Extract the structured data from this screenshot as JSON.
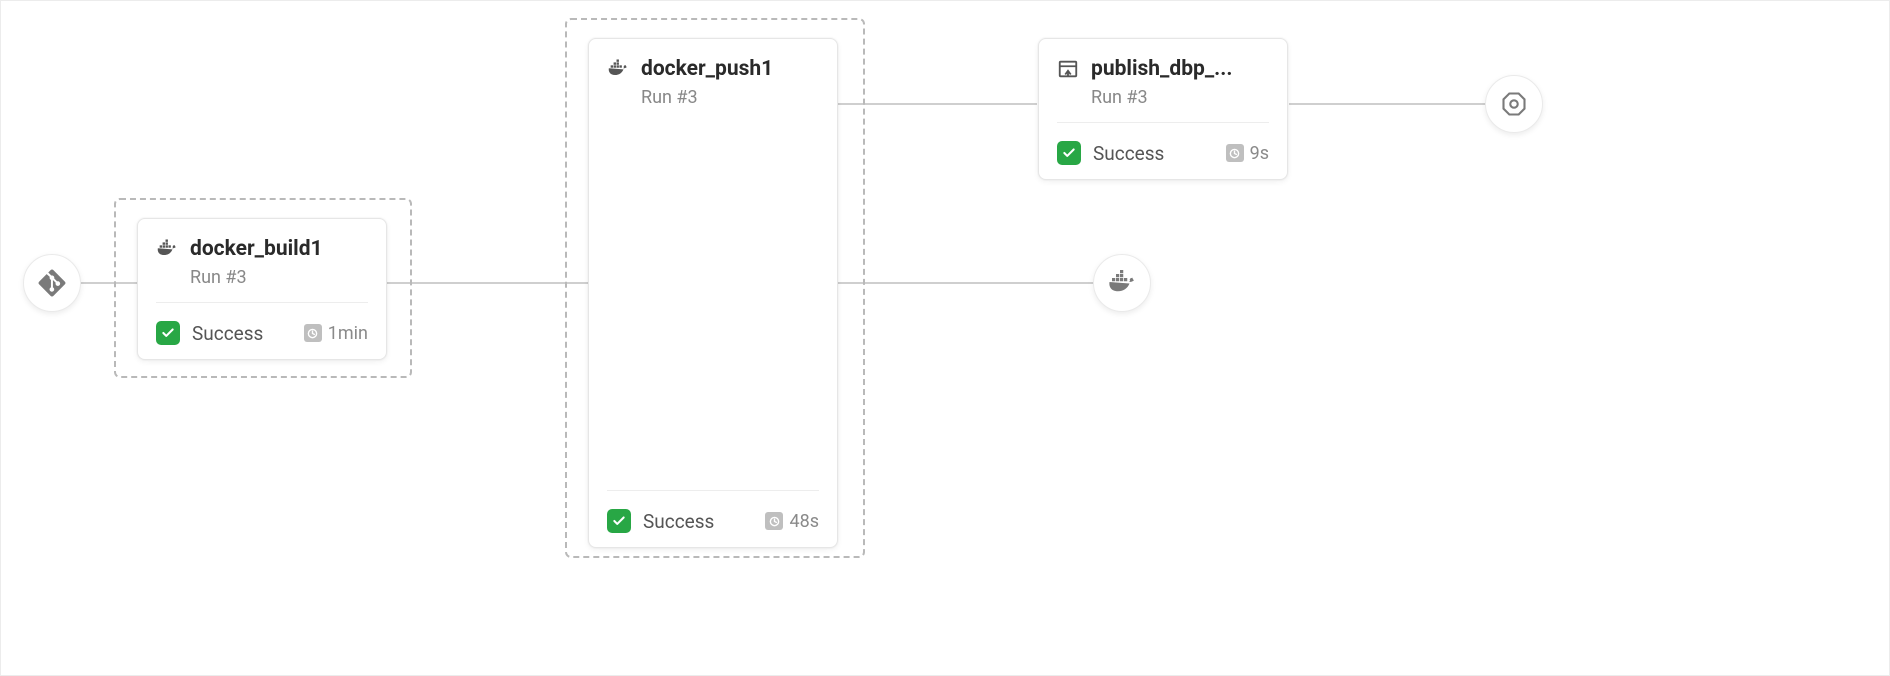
{
  "nodes": {
    "docker_build1": {
      "title": "docker_build1",
      "run_label": "Run #3",
      "status_text": "Success",
      "duration": "1min"
    },
    "docker_push1": {
      "title": "docker_push1",
      "run_label": "Run #3",
      "status_text": "Success",
      "duration": "48s"
    },
    "publish_dbp": {
      "title": "publish_dbp_...",
      "run_label": "Run #3",
      "status_text": "Success",
      "duration": "9s"
    }
  }
}
